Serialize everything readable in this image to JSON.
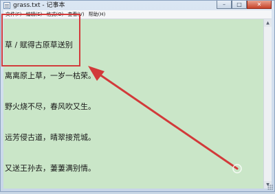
{
  "window": {
    "title": "grass.txt - 记事本",
    "controls": {
      "minimize": "–",
      "maximize": "□",
      "close": "✕"
    }
  },
  "menu": [
    {
      "label": "文件(F)"
    },
    {
      "label": "编辑(E)"
    },
    {
      "label": "格式(O)"
    },
    {
      "label": "查看(V)"
    },
    {
      "label": "帮助(H)"
    }
  ],
  "document": {
    "lines": [
      "草 / 赋得古原草送别",
      "离离原上草，一岁一枯荣。",
      "野火烧不尽，春风吹又生。",
      "远芳侵古道，晴翠接荒城。",
      "又送王孙去，萋萋满别情。"
    ]
  },
  "colors": {
    "editor_background": "#cae6c8",
    "annotation": "#d23a3a"
  },
  "icons": {
    "app": "notepad-icon",
    "annotation_arrow": "red-arrow-icon",
    "annotation_box": "red-highlight-box"
  }
}
